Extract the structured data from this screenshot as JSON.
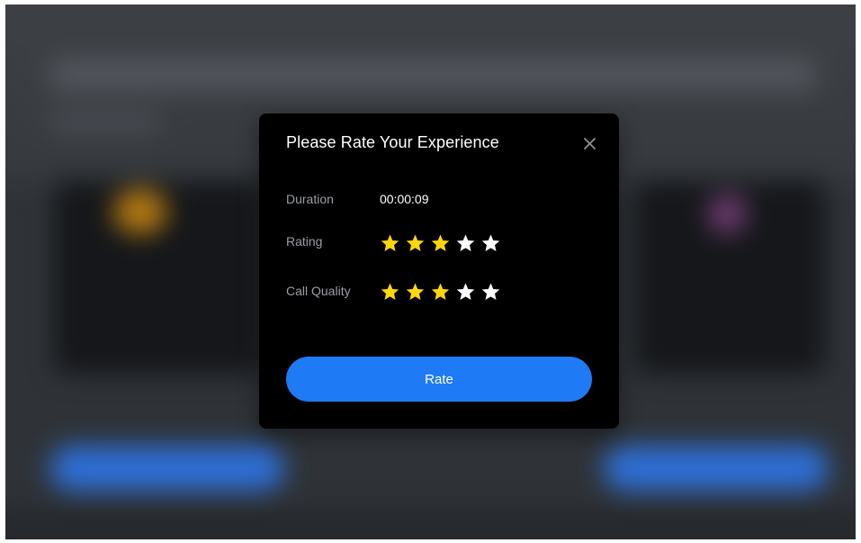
{
  "modal": {
    "title": "Please Rate Your Experience",
    "close_icon": "close-icon"
  },
  "duration": {
    "label": "Duration",
    "value": "00:00:09"
  },
  "rating": {
    "label": "Rating",
    "value": 3,
    "max": 5
  },
  "call_quality": {
    "label": "Call Quality",
    "value": 3,
    "max": 5
  },
  "rate_button": {
    "label": "Rate"
  },
  "colors": {
    "star_filled": "#ffd60a",
    "star_empty": "#ffffff",
    "accent": "#1f7af6",
    "modal_background": "#000000",
    "label_text": "#9b9fa6"
  }
}
